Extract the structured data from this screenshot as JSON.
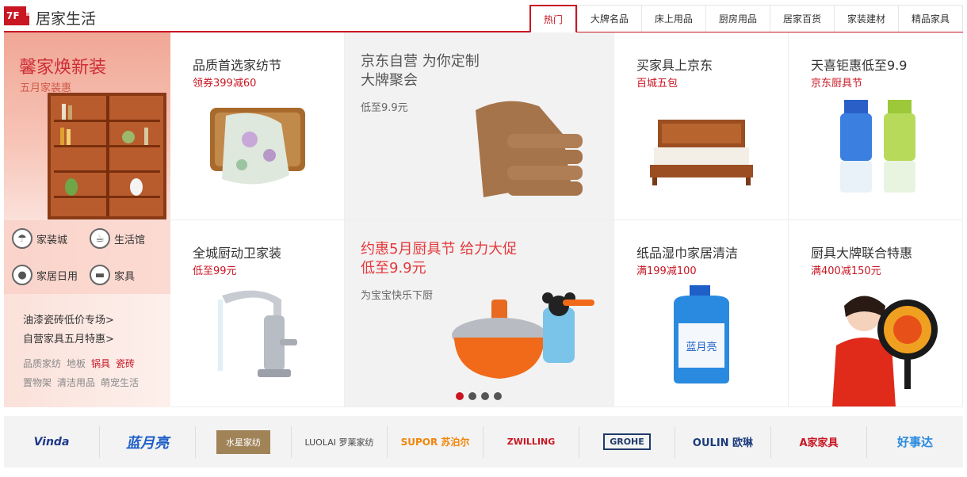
{
  "floor": {
    "number": "7F",
    "title": "居家生活",
    "brand_color": "#c81623"
  },
  "tabs": [
    "热门",
    "大牌名品",
    "床上用品",
    "厨房用品",
    "居家百货",
    "家装建材",
    "精品家具"
  ],
  "left": {
    "banner_title": "馨家焕新装",
    "banner_sub": "五月家装惠",
    "icons": [
      {
        "label": "家装城",
        "icon": "lamp-icon"
      },
      {
        "label": "生活馆",
        "icon": "teacup-icon"
      },
      {
        "label": "家居日用",
        "icon": "bulb-icon"
      },
      {
        "label": "家具",
        "icon": "sofa-icon"
      }
    ],
    "links": [
      "油漆瓷砖低价专场>",
      "自营家具五月特惠>"
    ],
    "tags": [
      {
        "label": "品质家纺",
        "hot": false
      },
      {
        "label": "地板",
        "hot": false
      },
      {
        "label": "锅具",
        "hot": true
      },
      {
        "label": "瓷砖",
        "hot": true
      },
      {
        "label": "置物架",
        "hot": false
      },
      {
        "label": "清洁用品",
        "hot": false
      },
      {
        "label": "萌宠生活",
        "hot": false
      }
    ]
  },
  "cells": {
    "c1": {
      "title": "品质首选家纺节",
      "sub": "领券399减60"
    },
    "big1": {
      "title1": "京东自营 为你定制",
      "title2": "大牌聚会",
      "sub": "低至9.9元"
    },
    "c2": {
      "title": "买家具上京东",
      "sub": "百城五包"
    },
    "c3": {
      "title": "天喜钜惠低至9.9",
      "sub": "京东厨具节"
    },
    "c4": {
      "title": "全城厨动卫家装",
      "sub": "低至99元"
    },
    "big2": {
      "title1": "约惠5月厨具节 给力大促",
      "title2": "低至9.9元",
      "sub": "为宝宝快乐下厨"
    },
    "c5": {
      "title": "纸品湿巾家居清洁",
      "sub": "满199减100"
    },
    "c6": {
      "title": "厨具大牌联合特惠",
      "sub": "满400减150元"
    }
  },
  "bottle_label": "蓝月亮",
  "brands": [
    "Vinda",
    "蓝月亮",
    "水星家纺",
    "LUOLAI 罗莱家纺",
    "SUPOR 苏泊尔",
    "ZWILLING",
    "GROHE",
    "OULIN 欧琳",
    "A家家具",
    "好事达"
  ]
}
